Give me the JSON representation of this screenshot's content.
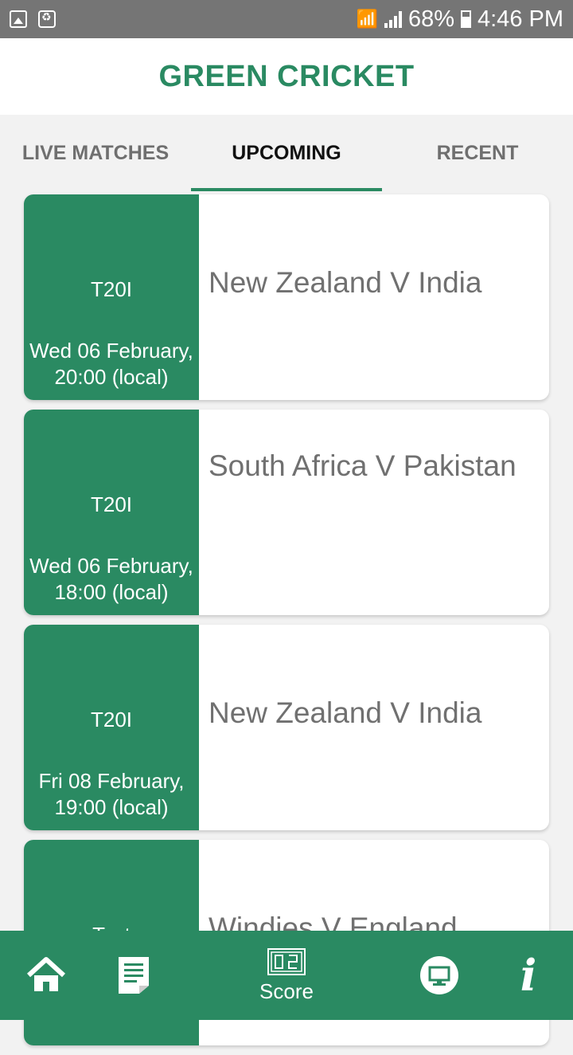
{
  "status_bar": {
    "battery_percent": "68%",
    "time": "4:46 PM",
    "icons": [
      "image-icon",
      "bag-icon",
      "wifi-icon",
      "signal-icon",
      "battery-icon"
    ]
  },
  "app": {
    "title": "GREEN CRICKET",
    "accent": "#2a8a62"
  },
  "tabs": [
    {
      "label": "LIVE MATCHES",
      "active": false
    },
    {
      "label": "UPCOMING",
      "active": true
    },
    {
      "label": "RECENT",
      "active": false
    }
  ],
  "matches": [
    {
      "format": "T20I",
      "date": "Wed 06 February, 20:00 (local)",
      "title": "New Zealand V India"
    },
    {
      "format": "T20I",
      "date": "Wed 06 February, 18:00 (local)",
      "title": "South Africa V Pakistan"
    },
    {
      "format": "T20I",
      "date": "Fri 08 February, 19:00 (local)",
      "title": "New Zealand V India"
    },
    {
      "format": "Test",
      "date": "",
      "title": "Windies V England"
    }
  ],
  "bottom_nav": {
    "score_label": "Score",
    "icons": [
      "home-icon",
      "news-icon",
      "scoreboard-icon",
      "tv-icon",
      "info-icon"
    ]
  }
}
